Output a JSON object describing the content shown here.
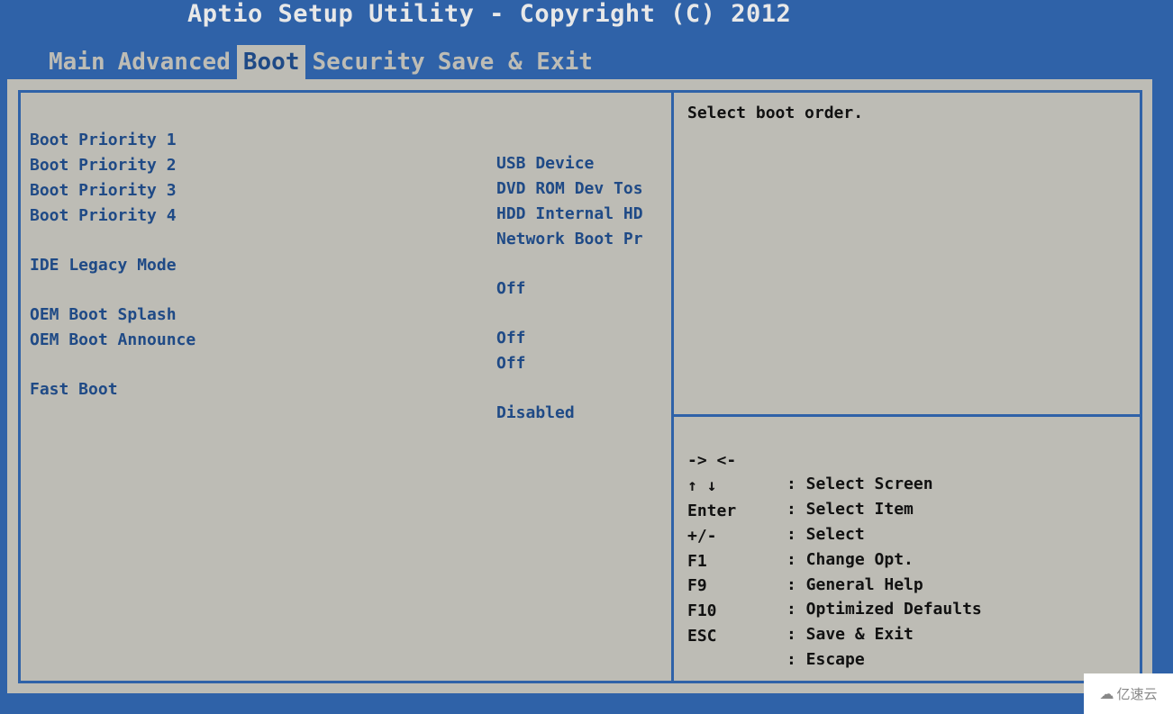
{
  "header": {
    "title": "Aptio Setup Utility - Copyright (C) 2012"
  },
  "tabs": [
    {
      "label": "Main",
      "active": false
    },
    {
      "label": "Advanced",
      "active": false
    },
    {
      "label": "Boot",
      "active": true
    },
    {
      "label": "Security",
      "active": false
    },
    {
      "label": "Save & Exit",
      "active": false
    }
  ],
  "settings": [
    {
      "label": "Boot Priority 1",
      "value": "USB Device"
    },
    {
      "label": "Boot Priority 2",
      "value": "DVD ROM Dev Tos"
    },
    {
      "label": "Boot Priority 3",
      "value": "HDD Internal HD"
    },
    {
      "label": "Boot Priority 4",
      "value": "Network Boot Pr"
    },
    {
      "label": "IDE Legacy Mode",
      "value": "Off"
    },
    {
      "label": "OEM Boot Splash",
      "value": "Off"
    },
    {
      "label": "OEM Boot Announce",
      "value": "Off"
    },
    {
      "label": "Fast Boot",
      "value": "Disabled"
    }
  ],
  "help": {
    "text": "Select boot order."
  },
  "keys": [
    {
      "key": "-> <-",
      "desc": ": Select Screen"
    },
    {
      "key": "↑ ↓",
      "desc": ": Select Item"
    },
    {
      "key": "Enter",
      "desc": ": Select"
    },
    {
      "key": "+/-",
      "desc": ": Change Opt."
    },
    {
      "key": "F1",
      "desc": ": General Help"
    },
    {
      "key": "F9",
      "desc": ": Optimized Defaults"
    },
    {
      "key": "F10",
      "desc": ": Save & Exit"
    },
    {
      "key": "ESC",
      "desc": ": Escape"
    }
  ],
  "watermark": {
    "text": "亿速云",
    "icon": "cloud-icon"
  },
  "colors": {
    "background": "#2f62a8",
    "panel": "#bdbcb5",
    "setting_text": "#1f4a86",
    "help_text": "#111111",
    "title_text": "#e8e8e8"
  }
}
